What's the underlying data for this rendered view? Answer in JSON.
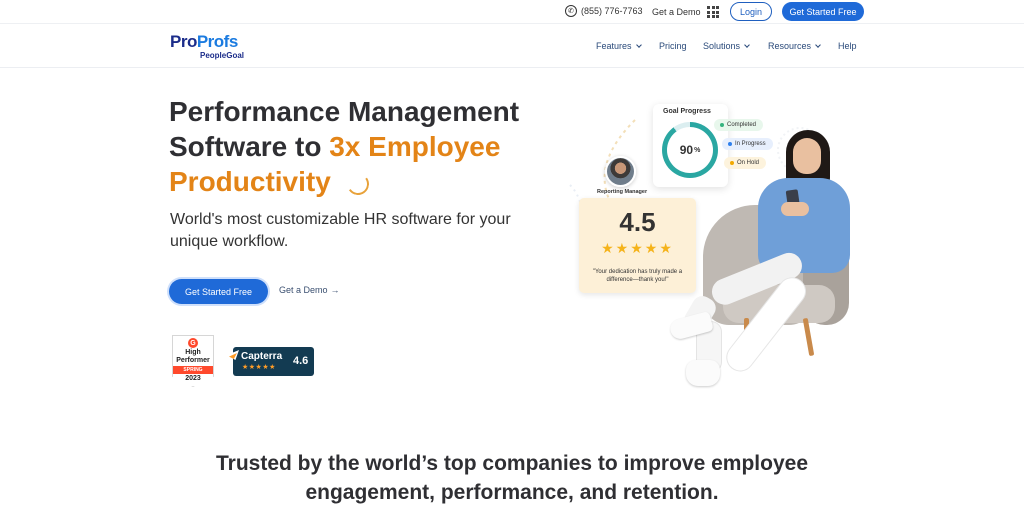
{
  "topbar": {
    "phone_icon": "phone-icon",
    "phone": "(855) 776-7763",
    "demo_link": "Get a Demo",
    "apps_icon": "grid-apps-icon",
    "login": "Login",
    "cta": "Get Started Free"
  },
  "nav": {
    "logo_part1": "Pro",
    "logo_part2": "Profs",
    "logo_sub": "PeopleGoal",
    "items": [
      {
        "label": "Features",
        "dropdown": true
      },
      {
        "label": "Pricing",
        "dropdown": false
      },
      {
        "label": "Solutions",
        "dropdown": true
      },
      {
        "label": "Resources",
        "dropdown": true
      },
      {
        "label": "Help",
        "dropdown": false
      }
    ]
  },
  "hero": {
    "title_line1": "Performance Management",
    "title_line2_plain": "Software to ",
    "title_line2_highlight": "3x Employee",
    "title_line3_highlight": "Productivity",
    "subtitle": "World's most customizable HR software for your unique workflow.",
    "primary_cta": "Get Started Free",
    "secondary_cta": "Get a Demo",
    "secondary_cta_arrow": "→",
    "accent_color": "#e38417",
    "primary_color": "#1f6ad8"
  },
  "badges": {
    "g2": {
      "logo": "G",
      "line1": "High",
      "line2": "Performer",
      "season": "SPRING",
      "year": "2023"
    },
    "capterra": {
      "name": "Capterra",
      "stars": "★★★★★",
      "score": "4.6"
    }
  },
  "illustration": {
    "goal_progress": {
      "title": "Goal Progress",
      "percent": "90",
      "percent_sign": "%",
      "fraction": 0.9,
      "statuses": [
        {
          "label": "Completed",
          "color": "#36b37e"
        },
        {
          "label": "In Progress",
          "color": "#2f80ed"
        },
        {
          "label": "On Hold",
          "color": "#f2a900"
        }
      ]
    },
    "manager_label": "Reporting Manager",
    "rating": {
      "score": "4.5",
      "stars": "★★★★★",
      "quote": "\"Your dedication has truly made a difference—thank you!\""
    }
  },
  "trusted": {
    "line1": "Trusted by the world’s top companies to improve employee",
    "line2": "engagement, performance, and retention."
  }
}
